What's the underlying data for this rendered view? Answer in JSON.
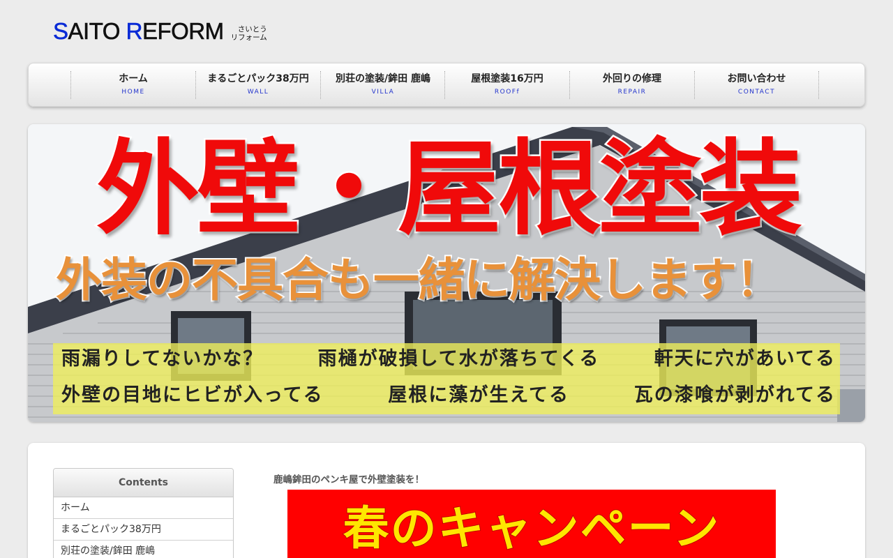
{
  "logo": {
    "s": "S",
    "aito": "AITO ",
    "r": "R",
    "eform": "EFORM",
    "sub_line1": "さいとう",
    "sub_line2": "リフォーム",
    "accent_color": "#0a2bd6"
  },
  "nav": {
    "items": [
      {
        "label": "ホーム",
        "sub": "HOME"
      },
      {
        "label": "まるごとパック38万円",
        "sub": "WALL"
      },
      {
        "label": "別荘の塗装/鉾田 鹿嶋",
        "sub": "VILLA"
      },
      {
        "label": "屋根塗装16万円",
        "sub": "ROOFf"
      },
      {
        "label": "外回りの修理",
        "sub": "REPAIR"
      },
      {
        "label": "お問い合わせ",
        "sub": "CONTACT"
      }
    ]
  },
  "hero": {
    "title": "外壁・屋根塗装",
    "subtitle": "外装の不具合も一緒に解決します！",
    "line1": [
      "雨漏りしてないかな？",
      "雨樋が破損して水が落ちてくる",
      "軒天に穴があいてる"
    ],
    "line2": [
      "外壁の目地にヒビが入ってる",
      "屋根に藻が生えてる",
      "瓦の漆喰が剥がれてる"
    ],
    "title_color": "#f00a0a",
    "subtitle_color": "#e8913a"
  },
  "sidebar": {
    "heading": "Contents",
    "items": [
      {
        "label": "ホーム"
      },
      {
        "label": "まるごとパック38万円"
      },
      {
        "label": "別荘の塗装/鉾田 鹿嶋"
      }
    ]
  },
  "main": {
    "heading": "鹿嶋鉾田のペンキ屋で外壁塗装を！",
    "campaign_text": "春のキャンペーン"
  }
}
